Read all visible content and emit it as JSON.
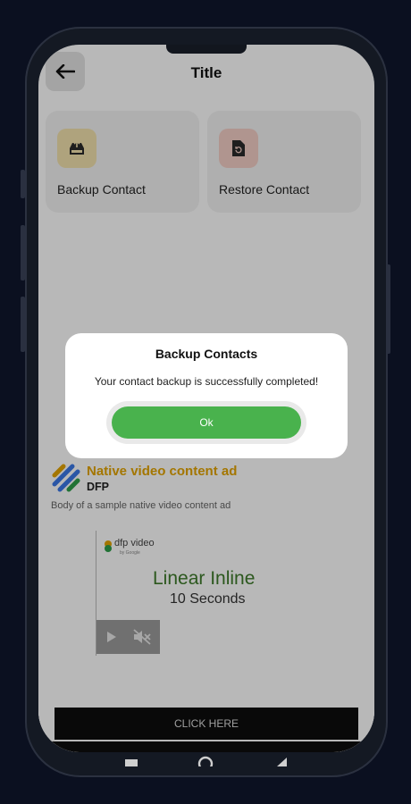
{
  "app": {
    "title": "Title"
  },
  "actions": [
    {
      "label": "Backup Contact",
      "icon": "inbox-upload-icon",
      "icon_bg": "#f3e2ad"
    },
    {
      "label": "Restore Contact",
      "icon": "file-restore-icon",
      "icon_bg": "#f4cfc6"
    }
  ],
  "ad": {
    "headline": "Native video content ad",
    "advertiser": "DFP",
    "body": "Body of a sample native video content ad",
    "video_brand": "dfp video",
    "video_brand_sub": "by Google",
    "video_line1": "Linear Inline",
    "video_line2": "10 Seconds",
    "cta": "CLICK HERE",
    "headline_color": "#e3a400"
  },
  "dialog": {
    "title": "Backup Contacts",
    "message": "Your contact backup is successfully completed!",
    "ok_label": "Ok",
    "ok_color": "#49b24d"
  }
}
